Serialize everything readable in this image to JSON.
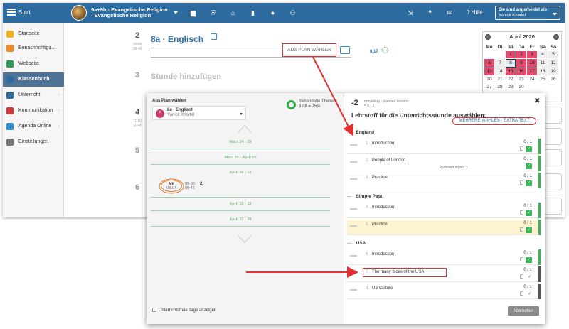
{
  "topbar": {
    "start_label": "Start",
    "course_line1": "9a+9b - Evangelische Religion",
    "course_line2": "- Evangelische Religion",
    "icons": [
      "briefcase-icon",
      "shield-icon",
      "institution-icon",
      "chart-icon",
      "palette-icon",
      "people-walk-icon",
      "export-icon",
      "chat-icon",
      "mail-icon"
    ],
    "help_label": "? Hilfe",
    "user_line1": "Sie sind angemeldet als",
    "user_line2": "Yanick Knodel"
  },
  "sidebar": {
    "items": [
      {
        "label": "Startseite",
        "icon": "star-icon",
        "color": "#f2b31c"
      },
      {
        "label": "Benachrichtigu...",
        "icon": "envelope-icon",
        "color": "#f08a24"
      },
      {
        "label": "Webseite",
        "icon": "home-icon",
        "color": "#2e9c5a"
      },
      {
        "label": "Klassenbuch",
        "icon": "book-icon",
        "color": "#4e7394"
      },
      {
        "label": "Unterricht",
        "icon": "briefcase-icon",
        "color": "#2d6a9e"
      },
      {
        "label": "Kommunikation",
        "icon": "chat-icon",
        "color": "#d23a3a"
      },
      {
        "label": "Agenda Online",
        "icon": "pencil-icon",
        "color": "#2d8fd1"
      },
      {
        "label": "Einstellungen",
        "icon": "gear-icon",
        "color": "#777777"
      }
    ]
  },
  "main": {
    "lessons": [
      {
        "num": "2",
        "start": "09:00",
        "end": "09:45"
      },
      {
        "num": "3"
      },
      {
        "num": "4",
        "start": "11:00",
        "end": "11:45"
      },
      {
        "num": "5"
      },
      {
        "num": "6"
      }
    ],
    "lesson_title": "8a · Englisch",
    "aus_plan_button": "AUS PLAN WÄHLEN",
    "count": "0/17",
    "add_lesson": "Stunde hinzufügen"
  },
  "calendar": {
    "title": "April 2020",
    "weekdays": [
      "Mo",
      "Di",
      "Mi",
      "Do",
      "Fr",
      "Sa",
      "So"
    ],
    "rows": [
      [
        {
          "d": ""
        },
        {
          "d": ""
        },
        {
          "d": "1",
          "c": "p"
        },
        {
          "d": "2",
          "c": "p"
        },
        {
          "d": "3",
          "c": "p"
        },
        {
          "d": "4",
          "c": "g"
        },
        {
          "d": "5",
          "c": "g"
        }
      ],
      [
        {
          "d": "6",
          "c": "p"
        },
        {
          "d": "7",
          "c": "g"
        },
        {
          "d": "8",
          "c": "s"
        },
        {
          "d": "9",
          "c": "p"
        },
        {
          "d": "10",
          "c": "p"
        },
        {
          "d": "11",
          "c": "g"
        },
        {
          "d": "12",
          "c": "g"
        }
      ],
      [
        {
          "d": "13",
          "c": "p"
        },
        {
          "d": "14",
          "c": "g"
        },
        {
          "d": "15",
          "c": "p"
        },
        {
          "d": "16",
          "c": "p"
        },
        {
          "d": "17",
          "c": "p"
        },
        {
          "d": "18",
          "c": "g"
        },
        {
          "d": "19",
          "c": "g"
        }
      ],
      [
        {
          "d": "20"
        },
        {
          "d": "21"
        },
        {
          "d": "22"
        },
        {
          "d": "23"
        },
        {
          "d": "24"
        },
        {
          "d": "25"
        },
        {
          "d": "26"
        }
      ],
      [
        {
          "d": "27"
        },
        {
          "d": "28"
        },
        {
          "d": "29"
        },
        {
          "d": "30"
        },
        {
          "d": ""
        },
        {
          "d": ""
        },
        {
          "d": ""
        }
      ]
    ]
  },
  "dialog": {
    "left": {
      "label": "Aus Plan wählen",
      "course_initial": "E",
      "course_name": "8a · Englisch",
      "course_teacher": "Yanick Knodel",
      "treated_label": "Behandelte Themen",
      "treated_value": "6 / 8 = 75%",
      "weeks": [
        "März 24 - 29",
        "März 30 - April 05",
        "April 06 - 12",
        "April 19 - 13",
        "April 21 - 28"
      ],
      "slot_day": "Mit",
      "slot_date": "08.04",
      "slot_start": "09:00",
      "slot_end": "09:45",
      "slot_num": "2.",
      "free_days_label": "Unterrichtsfreie Tage anzeigen"
    },
    "right": {
      "neg": "-2",
      "remaining_line1": "remaining - planned lessons:",
      "remaining_line2": "= 0 - 2",
      "close": "✖",
      "title": "Lehrstoff für die Unterrichtsstunde auswählen:",
      "mehr_button": "MEHRERE WÄHLEN · EXTRA TEXT",
      "chapters": [
        {
          "name": "England",
          "items": [
            {
              "no": "1.",
              "name": "Introduction",
              "score": "0 / 1",
              "state": "done"
            },
            {
              "no": "2.",
              "name": "People of London",
              "score": "0 / 1",
              "state": "done",
              "note": "Vorbereitungen: 1"
            },
            {
              "no": "3.",
              "name": "Practice",
              "score": "0 / 1",
              "state": "done"
            }
          ]
        },
        {
          "name": "Simple Past",
          "items": [
            {
              "no": "4.",
              "name": "Introduction",
              "score": "0 / 1",
              "state": "done"
            },
            {
              "no": "5.",
              "name": "Practice",
              "score": "0 / 1",
              "state": "done",
              "highlight": true
            }
          ]
        },
        {
          "name": "USA",
          "items": [
            {
              "no": "6.",
              "name": "Introduction",
              "score": "0 / 1",
              "state": "done"
            },
            {
              "no": "7.",
              "name": "The many faces of the USA",
              "score": "0 / 1",
              "state": "open"
            },
            {
              "no": "8.",
              "name": "US Culture",
              "score": "0 / 1",
              "state": "open"
            }
          ]
        }
      ],
      "cancel_button": "Abbrechen"
    }
  },
  "colors": {
    "topbar": "#2d6a9e",
    "accent_green": "#3db35a",
    "highlight_red": "#e03030",
    "calendar_pink": "#e04a6d"
  }
}
